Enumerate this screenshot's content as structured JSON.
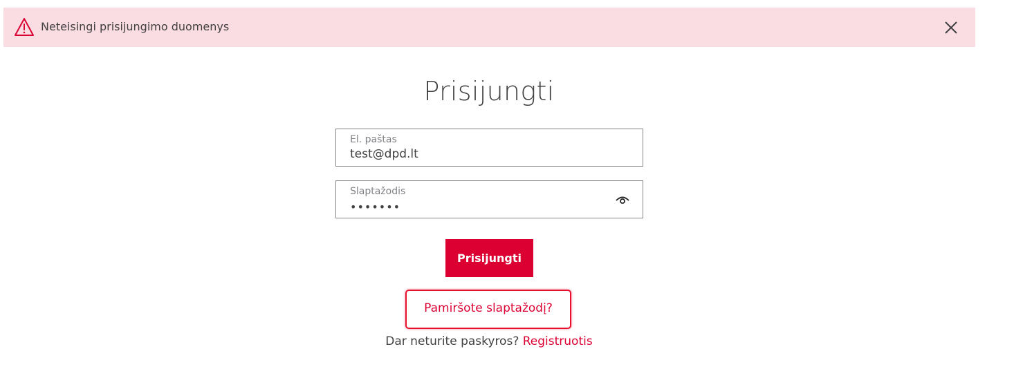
{
  "alert": {
    "message": "Neteisingi prisijungimo duomenys",
    "icon": "warning-triangle-icon",
    "close_icon": "close-icon",
    "background": "#fadde2",
    "accent": "#dc0032"
  },
  "login": {
    "title": "Prisijungti",
    "email": {
      "label": "El. paštas",
      "value": "test@dpd.lt"
    },
    "password": {
      "label": "Slaptažodis",
      "value": "•••••••",
      "toggle_icon": "eye-icon"
    },
    "submit_label": "Prisijungti",
    "forgot_label": "Pamiršote slaptažodį?",
    "register_prompt": "Dar neturite paskyros?",
    "register_label": "Registruotis"
  },
  "colors": {
    "brand": "#dc0032",
    "text": "#414042",
    "muted": "#808285"
  }
}
